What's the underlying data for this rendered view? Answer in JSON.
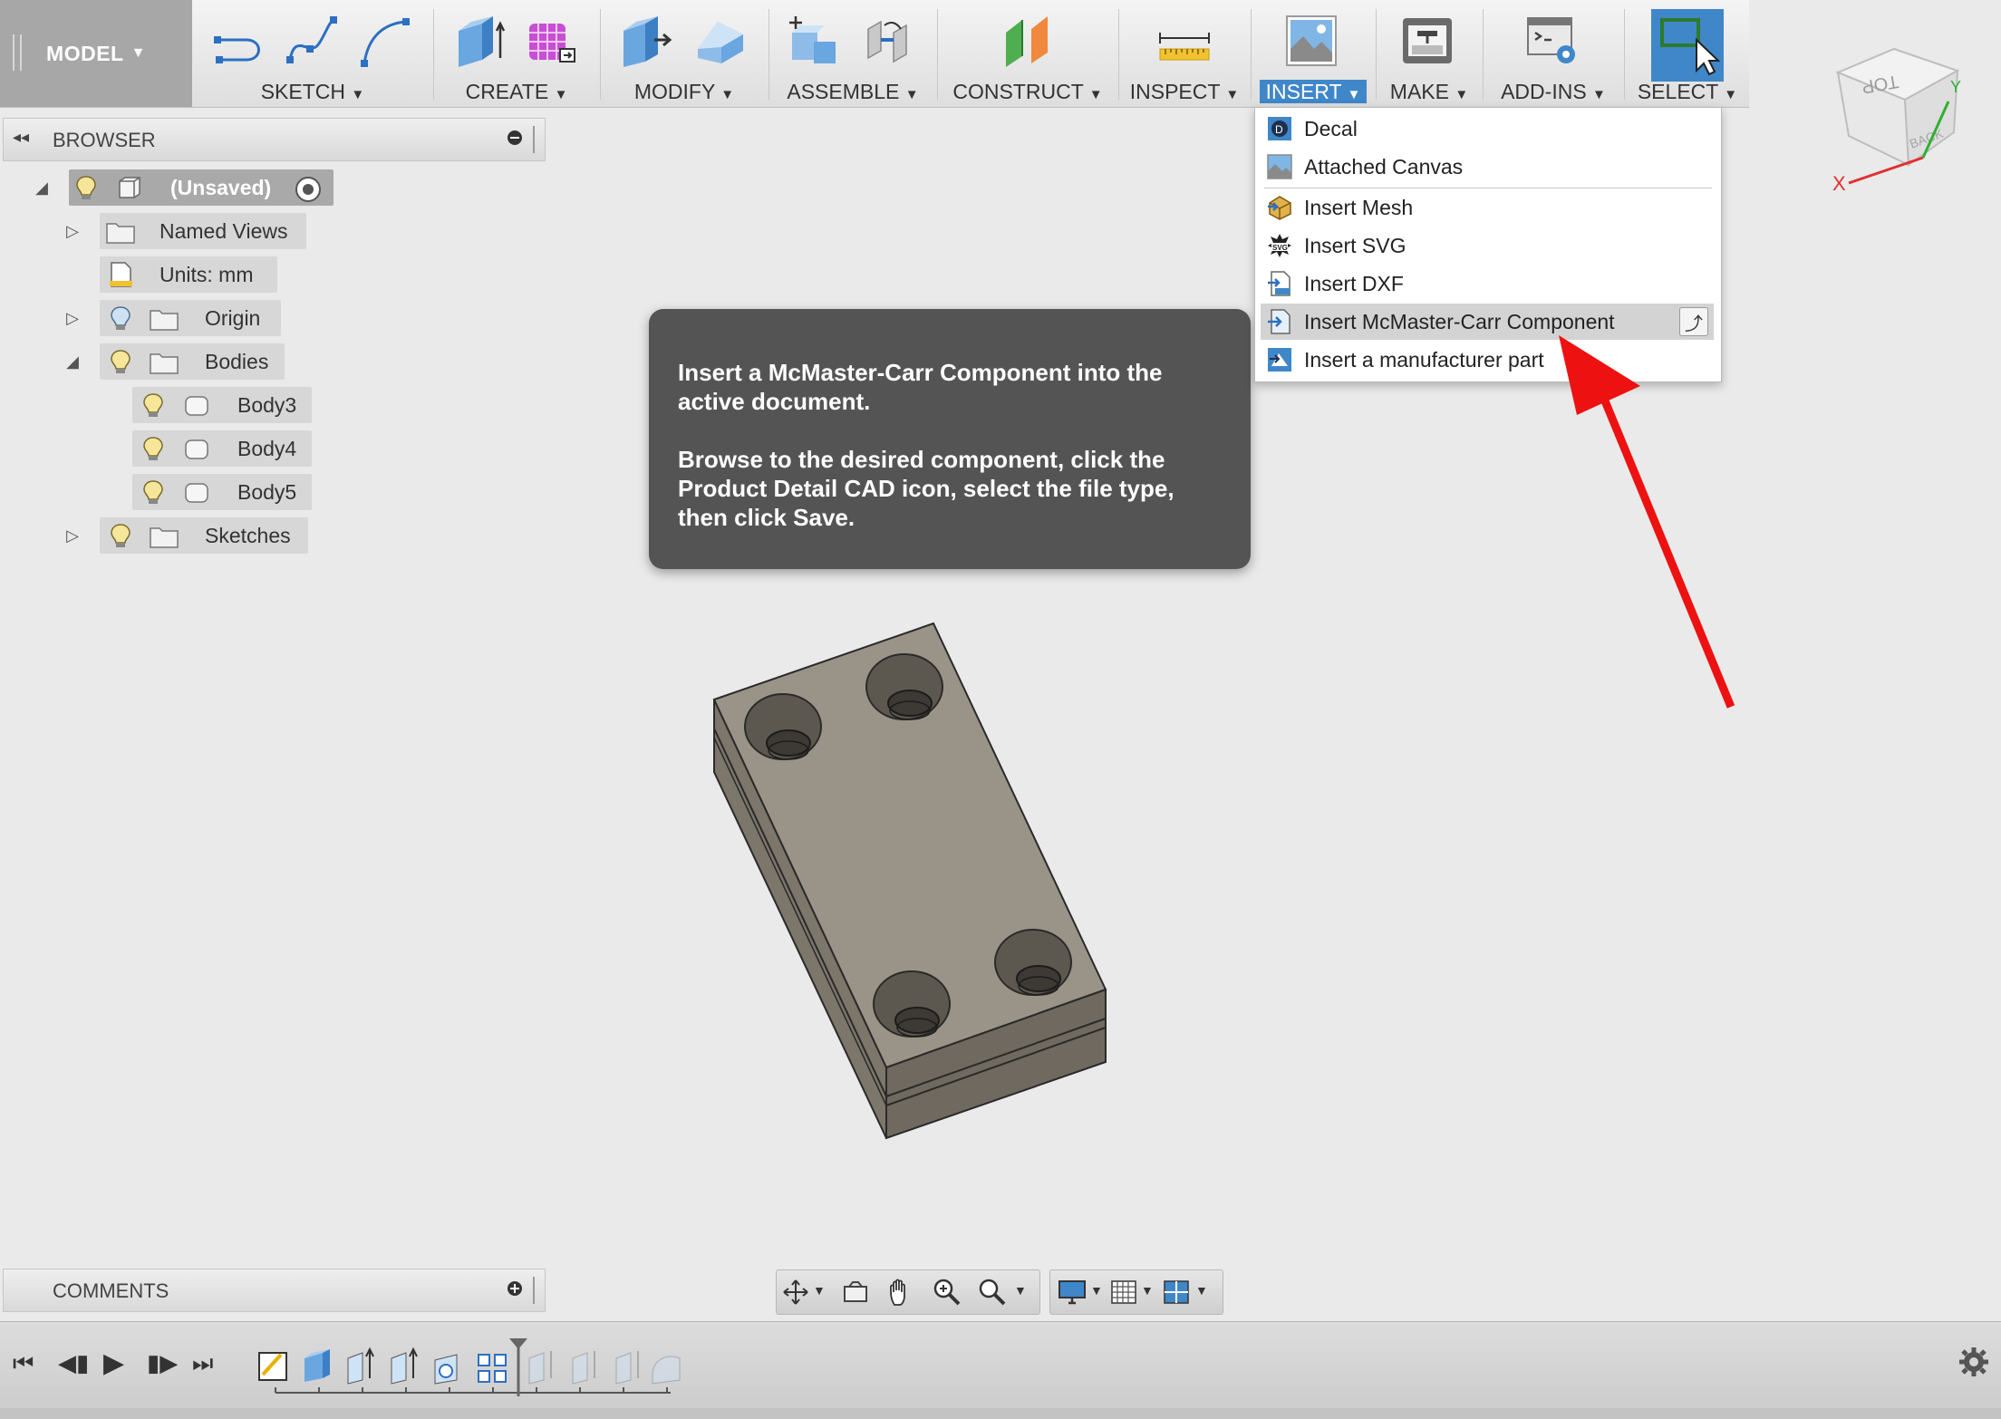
{
  "toolbar": {
    "workspace": "MODEL",
    "groups": [
      {
        "label": "SKETCH"
      },
      {
        "label": "CREATE"
      },
      {
        "label": "MODIFY"
      },
      {
        "label": "ASSEMBLE"
      },
      {
        "label": "CONSTRUCT"
      },
      {
        "label": "INSPECT"
      },
      {
        "label": "INSERT"
      },
      {
        "label": "MAKE"
      },
      {
        "label": "ADD-INS"
      },
      {
        "label": "SELECT"
      }
    ],
    "active_group": "INSERT",
    "accent_color": "#3f87c9"
  },
  "viewcube": {
    "face_top": "TOP",
    "face_back": "BACK",
    "axis_x": "X",
    "axis_y": "Y"
  },
  "browser": {
    "title": "BROWSER",
    "root": {
      "label": "(Unsaved)"
    },
    "items": [
      {
        "label": "Named Views"
      },
      {
        "label": "Units: mm"
      },
      {
        "label": "Origin"
      },
      {
        "label": "Bodies"
      },
      {
        "label": "Body3"
      },
      {
        "label": "Body4"
      },
      {
        "label": "Body5"
      },
      {
        "label": "Sketches"
      }
    ]
  },
  "insert_menu": {
    "items": [
      {
        "label": "Decal"
      },
      {
        "label": "Attached Canvas"
      },
      {
        "label": "Insert Mesh"
      },
      {
        "label": "Insert SVG"
      },
      {
        "label": "Insert DXF"
      },
      {
        "label": "Insert McMaster-Carr Component"
      },
      {
        "label": "Insert a manufacturer part"
      }
    ],
    "highlighted": "Insert McMaster-Carr Component"
  },
  "tooltip": {
    "line1": "Insert a McMaster-Carr Component into the active document.",
    "line2": "Browse to the desired component, click the Product Detail CAD icon, select the file type, then click Save."
  },
  "annotation_arrow_color": "#ee1111",
  "comments": {
    "title": "COMMENTS"
  }
}
